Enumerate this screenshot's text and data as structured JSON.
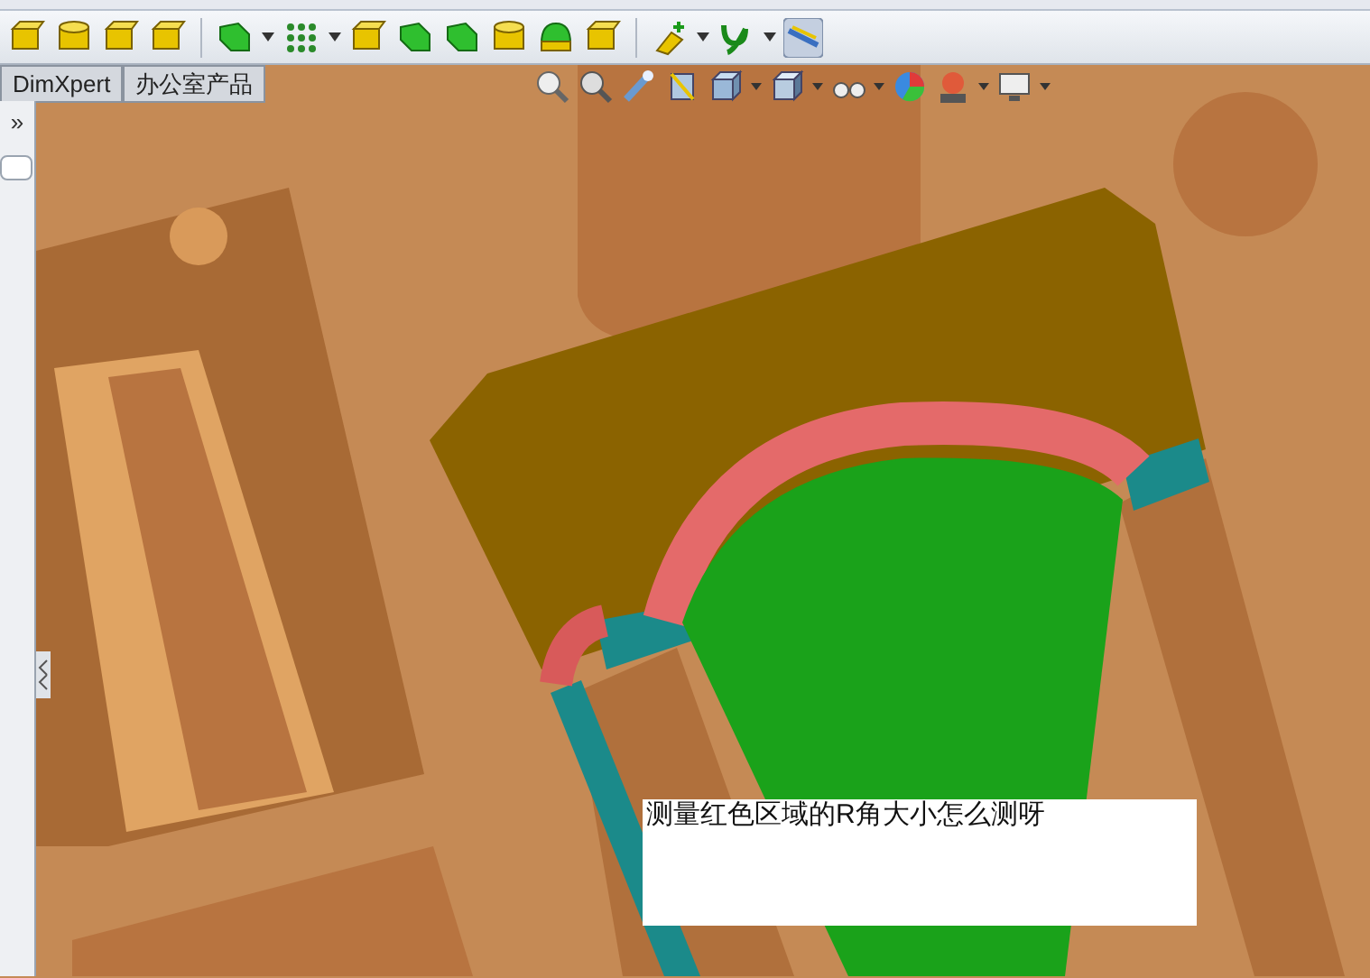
{
  "tabs": [
    {
      "label": "DimXpert",
      "selected": false
    },
    {
      "label": "办公室产品",
      "selected": false
    }
  ],
  "panel_toggle": "»",
  "note": {
    "text": "测量红色区域的R角大小怎么测呀"
  }
}
